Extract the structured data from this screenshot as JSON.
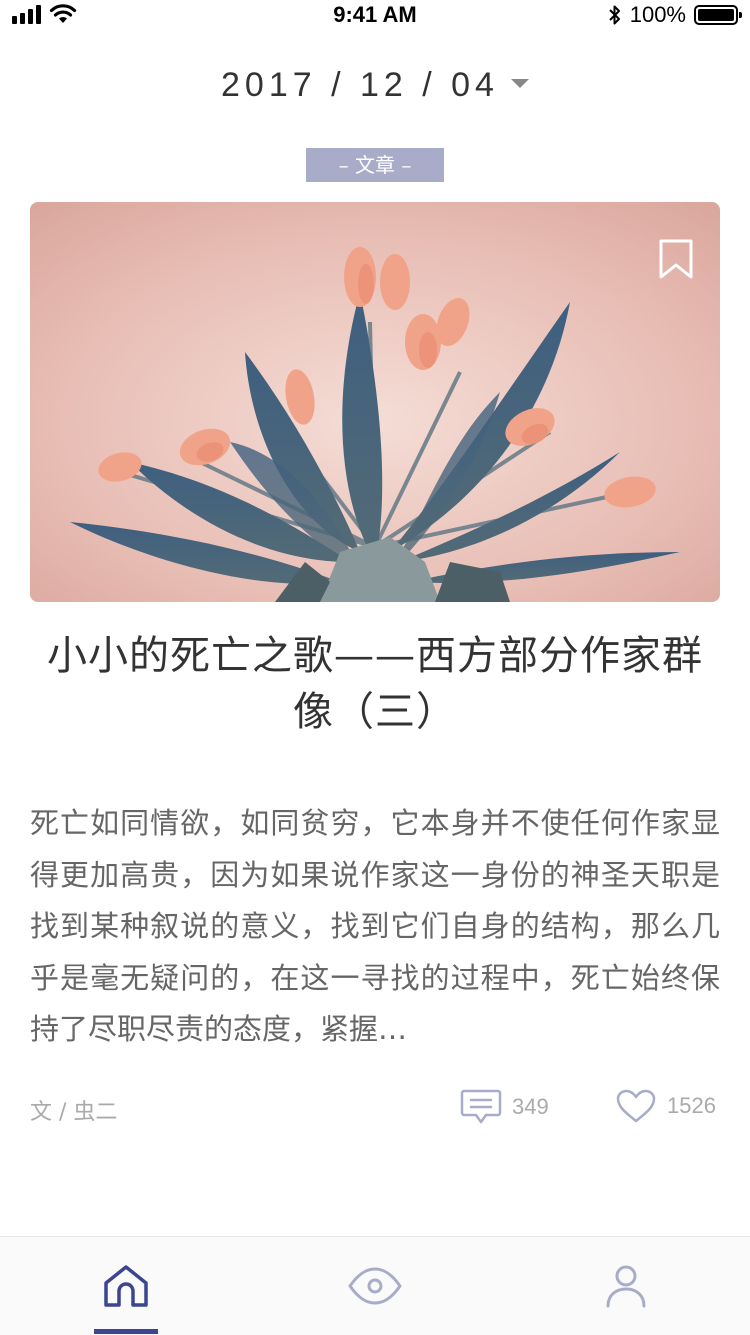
{
  "status_bar": {
    "time": "9:41 AM",
    "battery": "100%"
  },
  "date": {
    "text": "2017 / 12 / 04"
  },
  "article": {
    "category": "– 文章 –",
    "title": "小小的死亡之歌——西方部分作家群像（三）",
    "excerpt": "死亡如同情欲，如同贫穷，它本身并不使任何作家显得更加高贵，因为如果说作家这一身份的神圣天职是找到某种叙说的意义，找到它们自身的结构，那么几乎是毫无疑问的，在这一寻找的过程中，死亡始终保持了尽职尽责的态度，紧握…",
    "author": "文 / 虫二",
    "comments": "349",
    "likes": "1526"
  },
  "colors": {
    "accent": "#3b4590",
    "tag_bg": "#a9acc9",
    "icon_muted": "#a9acc9"
  },
  "tabbar": {
    "items": [
      {
        "icon": "home-icon",
        "active": true
      },
      {
        "icon": "eye-icon",
        "active": false
      },
      {
        "icon": "user-icon",
        "active": false
      }
    ]
  }
}
